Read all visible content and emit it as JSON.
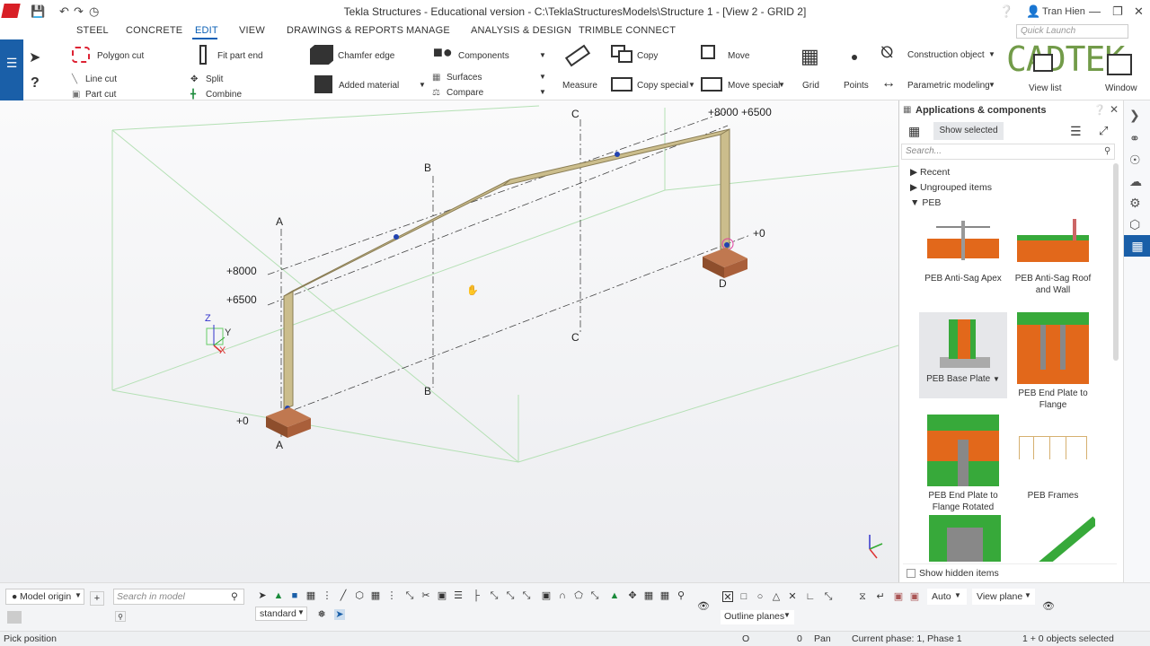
{
  "window": {
    "title": "Tekla Structures - Educational version - C:\\TeklaStructuresModels\\Structure 1  - [View 2 - GRID 2]",
    "user": "Tran Hien"
  },
  "menu_tabs": [
    "STEEL",
    "CONCRETE",
    "EDIT",
    "VIEW",
    "DRAWINGS & REPORTS",
    "MANAGE",
    "ANALYSIS & DESIGN",
    "TRIMBLE CONNECT"
  ],
  "active_tab": "EDIT",
  "quick_launch_placeholder": "Quick Launch",
  "ribbon": {
    "polygon_cut": "Polygon cut",
    "line_cut": "Line cut",
    "part_cut": "Part cut",
    "fit_part_end": "Fit part end",
    "split": "Split",
    "combine": "Combine",
    "chamfer_edge": "Chamfer edge",
    "added_material": "Added material",
    "components": "Components",
    "surfaces": "Surfaces",
    "compare": "Compare",
    "measure": "Measure",
    "copy": "Copy",
    "copy_special": "Copy special",
    "move": "Move",
    "move_special": "Move special",
    "grid": "Grid",
    "points": "Points",
    "construction_object": "Construction object",
    "parametric_modeling": "Parametric modeling",
    "view_list": "View list",
    "window": "Window",
    "watermark": "CADTEK"
  },
  "viewport": {
    "grid_labels": {
      "a_top": "A",
      "a_bottom": "A",
      "b_top": "B",
      "b_bottom": "B",
      "c_top": "C",
      "c_bottom": "C",
      "d": "D"
    },
    "level_labels": {
      "left_8000": "+8000",
      "left_6500": "+6500",
      "left_0": "+0",
      "right_0": "+0",
      "top_right": "+8000 +6500"
    },
    "axis_labels": {
      "z": "Z",
      "y": "Y",
      "x": "X"
    }
  },
  "panel": {
    "title": "Applications & components",
    "show_selected": "Show selected",
    "search_placeholder": "Search...",
    "tree": [
      "Recent",
      "Ungrouped items",
      "PEB"
    ],
    "components": [
      {
        "label": "PEB Anti-Sag Apex"
      },
      {
        "label": "PEB Anti-Sag Roof and Wall"
      },
      {
        "label": "PEB Base Plate"
      },
      {
        "label": "PEB End Plate to Flange"
      },
      {
        "label": "PEB End Plate to Flange Rotated"
      },
      {
        "label": "PEB Frames"
      }
    ],
    "show_hidden": "Show hidden items"
  },
  "bottom": {
    "model_origin": "Model origin",
    "search_placeholder": "Search in model",
    "standard": "standard",
    "auto": "Auto",
    "view_plane": "View plane",
    "outline_planes": "Outline planes"
  },
  "status": {
    "left": "Pick position",
    "o": "O",
    "zero": "0",
    "pan": "Pan",
    "phase": "Current phase: 1, Phase 1",
    "selected": "1 + 0 objects selected"
  },
  "colors": {
    "accent": "#1a5fa8",
    "steel": "#c8b98a",
    "footing": "#a0603c",
    "peb_orange": "#e2681b",
    "peb_green": "#37a93a"
  }
}
